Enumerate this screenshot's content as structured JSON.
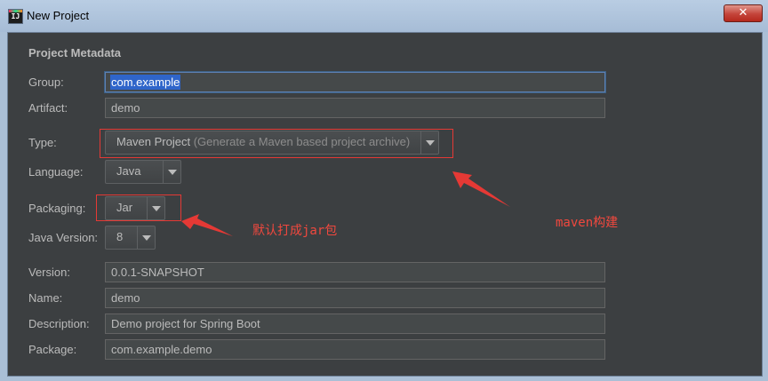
{
  "window": {
    "title": "New Project",
    "app_icon_text": "IJ",
    "close_label": "✕"
  },
  "section": {
    "title": "Project Metadata"
  },
  "fields": {
    "group": {
      "label": "Group:",
      "value": "com.example"
    },
    "artifact": {
      "label": "Artifact:",
      "value": "demo"
    },
    "type": {
      "label": "Type:",
      "value": "Maven Project",
      "hint": "(Generate a Maven based project archive)"
    },
    "language": {
      "label": "Language:",
      "value": "Java"
    },
    "packaging": {
      "label": "Packaging:",
      "value": "Jar"
    },
    "java_version": {
      "label": "Java Version:",
      "value": "8"
    },
    "version": {
      "label": "Version:",
      "value": "0.0.1-SNAPSHOT"
    },
    "name": {
      "label": "Name:",
      "value": "demo"
    },
    "description": {
      "label": "Description:",
      "value": "Demo project for Spring Boot"
    },
    "package": {
      "label": "Package:",
      "value": "com.example.demo"
    }
  },
  "annotations": {
    "packaging_note": "默认打成jar包",
    "type_note": "maven构建"
  },
  "colors": {
    "annotation": "#e53935",
    "dialog_background": "#3c3f41",
    "selection": "#2f65ca"
  }
}
